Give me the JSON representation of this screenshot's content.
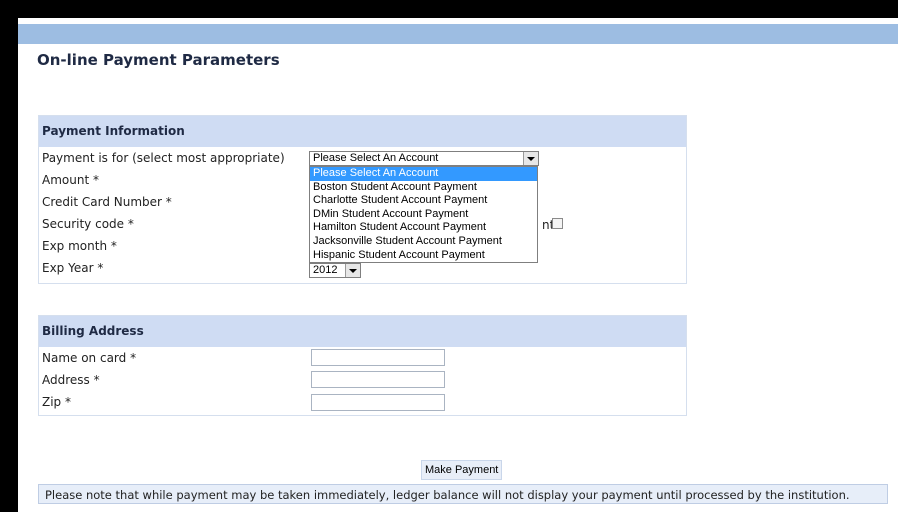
{
  "page": {
    "title": "On-line Payment Parameters"
  },
  "payment_section": {
    "header": "Payment Information",
    "labels": {
      "payment_for": "Payment is for (select most appropriate)",
      "amount": "Amount *",
      "card_number": "Credit Card Number *",
      "security_code": "Security code *",
      "exp_month": "Exp month *",
      "exp_year": "Exp Year *"
    },
    "account_select": {
      "value": "Please Select An Account",
      "options": [
        "Please Select An Account",
        "Boston Student Account Payment",
        "Charlotte Student Account Payment",
        "DMin Student Account Payment",
        "Hamilton Student Account Payment",
        "Jacksonville Student Account Payment",
        "Hispanic Student Account Payment"
      ],
      "selected_index": 0
    },
    "exp_year_select": {
      "value": "2012"
    },
    "partially_hidden_text": "nt"
  },
  "billing_section": {
    "header": "Billing Address",
    "labels": {
      "name": "Name on card *",
      "address": "Address *",
      "zip": "Zip *"
    }
  },
  "actions": {
    "make_payment": "Make Payment"
  },
  "notice": "Please note that while payment may be taken immediately, ledger balance will not display your payment until processed by the institution.",
  "colors": {
    "top_band": "#9dbde2",
    "section_header": "#cfdcf3",
    "selected_option": "#3399ff"
  }
}
